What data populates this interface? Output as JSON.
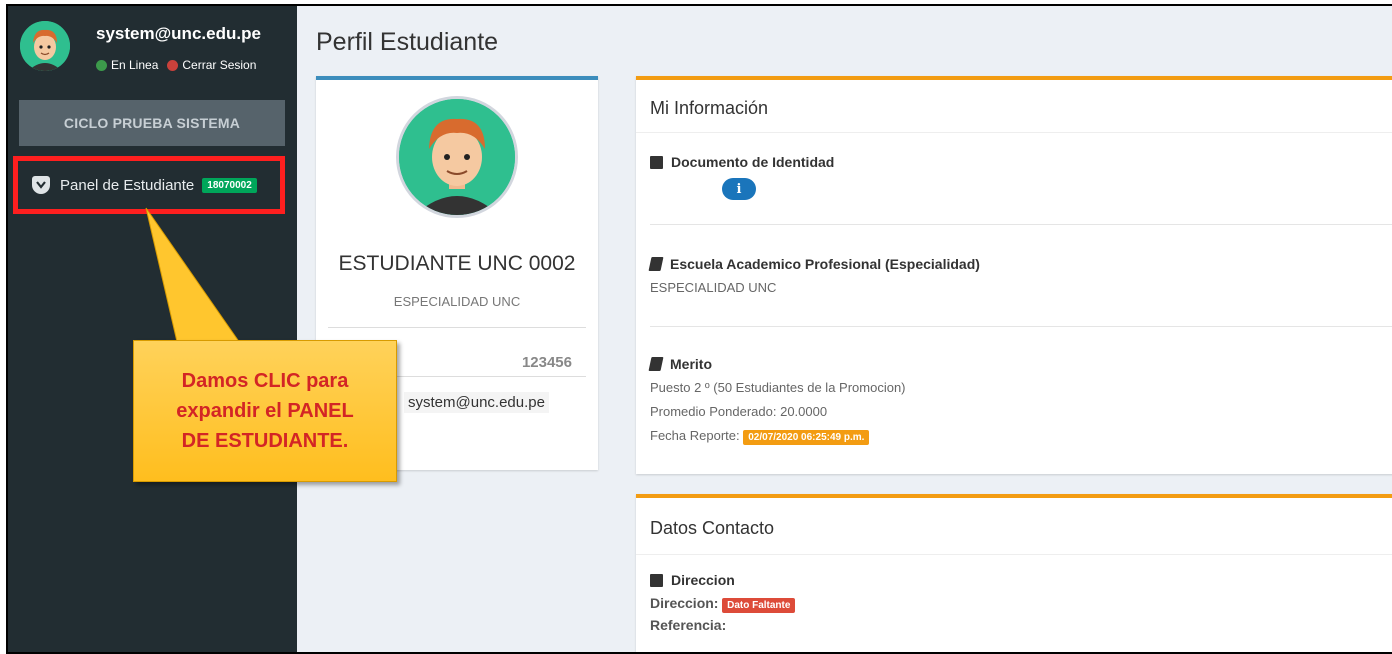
{
  "sidebar": {
    "user_email": "system@unc.edu.pe",
    "status_online": "En Linea",
    "logout": "Cerrar Sesion",
    "cycle_button": "CICLO PRUEBA SISTEMA",
    "panel_item_label": "Panel de Estudiante",
    "panel_item_badge": "18070002"
  },
  "page_title": "Perfil Estudiante",
  "profile": {
    "name": "ESTUDIANTE UNC 0002",
    "specialty": "ESPECIALIDAD UNC",
    "code": "123456",
    "email": "system@unc.edu.pe"
  },
  "mi_informacion": {
    "title": "Mi Información",
    "documento_title": "Documento de Identidad",
    "info_button": "i",
    "escuela_title": "Escuela Academico Profesional (Especialidad)",
    "escuela_value": "ESPECIALIDAD UNC",
    "merito_title": "Merito",
    "puesto": "Puesto 2 º (50 Estudiantes de la Promocion)",
    "promedio": "Promedio Ponderado: 20.0000",
    "fecha_label": "Fecha Reporte:",
    "fecha_value": "02/07/2020 06:25:49 p.m."
  },
  "datos_contacto": {
    "title": "Datos Contacto",
    "direccion_title": "Direccion",
    "direccion_label": "Direccion:",
    "direccion_badge": "Dato Faltante",
    "referencia_label": "Referencia:"
  },
  "callout": {
    "line1": "Damos CLIC para",
    "line2": "expandir el PANEL",
    "line3": "DE ESTUDIANTE."
  },
  "colors": {
    "sidebar_bg": "#222d32",
    "highlight_border": "#ff1f1f",
    "badge_green": "#00a65a",
    "accent_blue": "#3c8dbc",
    "accent_orange": "#f39c12",
    "badge_red": "#dd4b39",
    "callout_text": "#d32525"
  }
}
